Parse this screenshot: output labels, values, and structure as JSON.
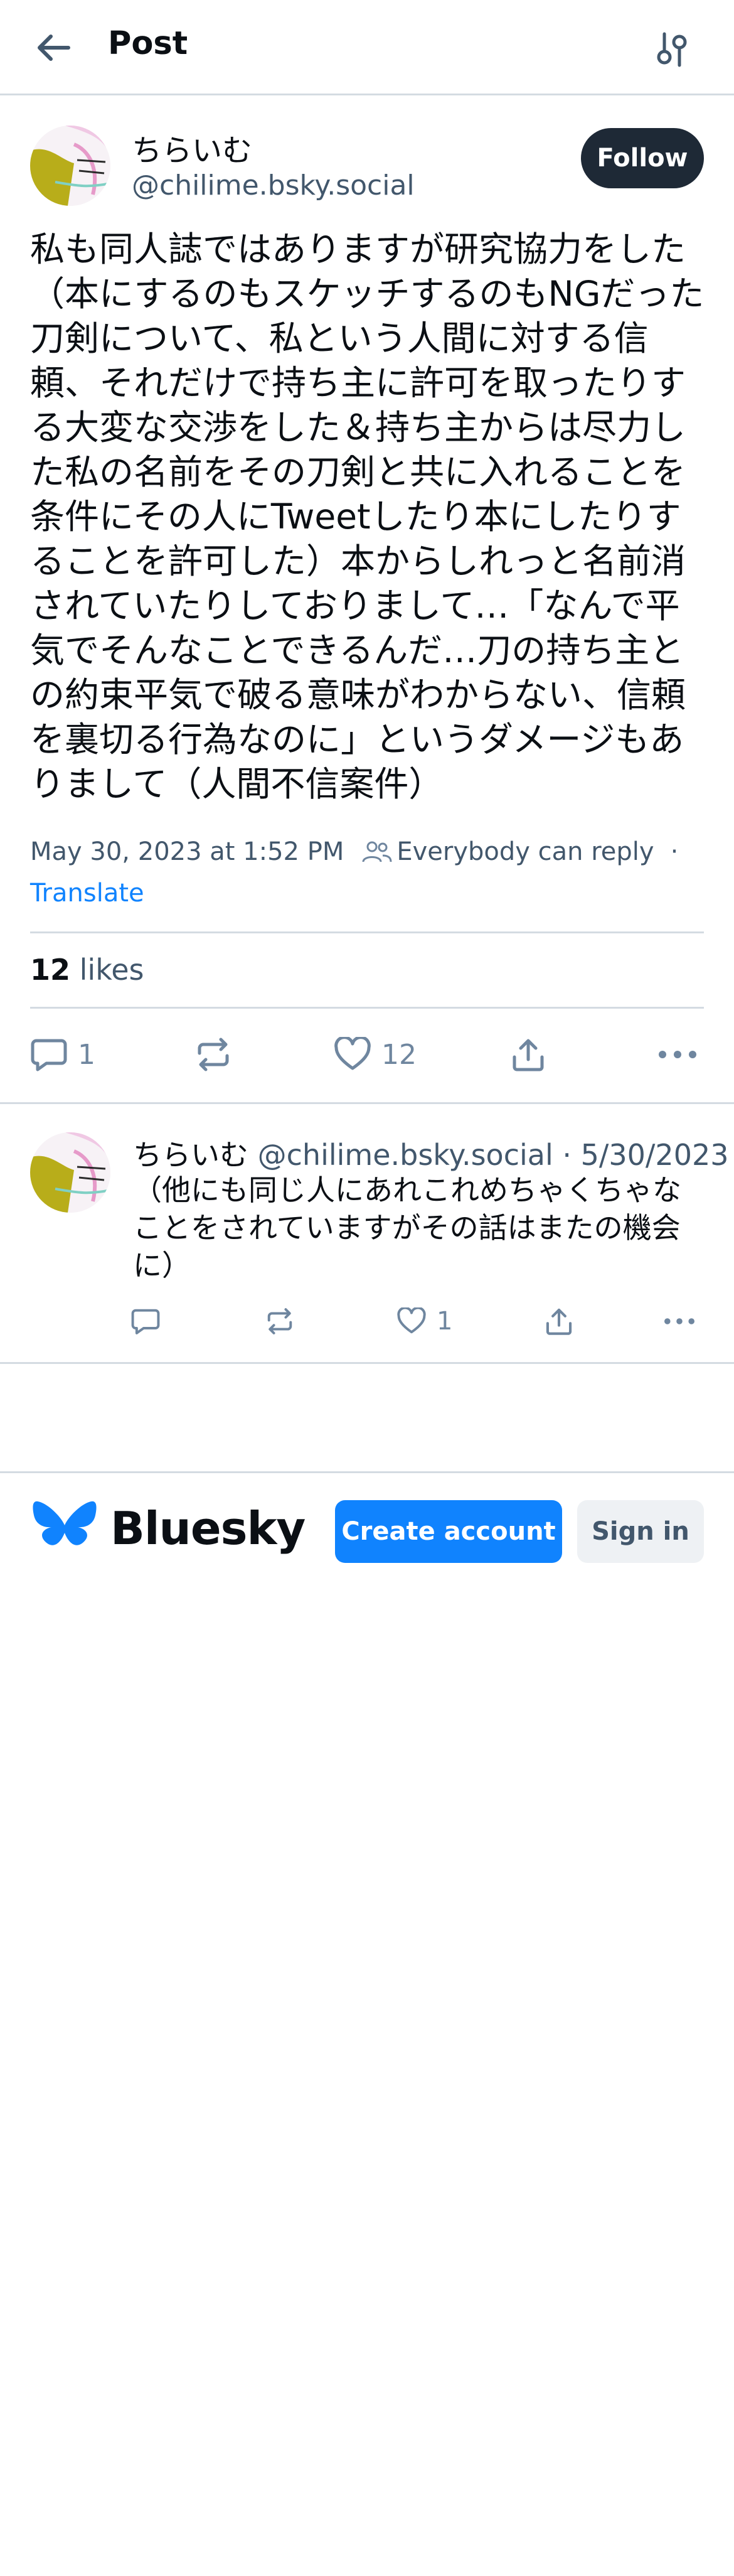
{
  "header": {
    "title": "Post",
    "back_icon": "arrow-left-icon",
    "settings_icon": "sliders-icon"
  },
  "post": {
    "author": {
      "display_name": "ちらいむ",
      "handle": "@chilime.bsky.social"
    },
    "follow_label": "Follow",
    "text": "私も同人誌ではありますが研究協力をした（本にするのもスケッチするのもNGだった刀剣について、私という人間に対する信頼、それだけで持ち主に許可を取ったりする大変な交渉をした＆持ち主からは尽力した私の名前をその刀剣と共に入れることを条件にその人にTweetしたり本にしたりすることを許可した）本からしれっと名前消されていたりしておりまして…「なんで平気でそんなことできるんだ…刀の持ち主との約束平気で破る意味がわからない、信頼を裏切る行為なのに」というダメージもありまして（人間不信案件）",
    "timestamp": "May 30, 2023 at 1:52 PM",
    "audience": "Everybody can reply",
    "meta_separator": "·",
    "translate_label": "Translate",
    "likes_count": "12",
    "likes_label": "likes",
    "actions": {
      "reply_count": "1",
      "repost_count": "",
      "like_count": "12"
    }
  },
  "reply": {
    "author": {
      "display_name": "ちらいむ",
      "handle": "@chilime.bsky.social"
    },
    "separator": "·",
    "date": "5/30/2023",
    "text": "（他にも同じ人にあれこれめちゃくちゃなことをされていますがその話はまたの機会に）",
    "actions": {
      "reply_count": "",
      "repost_count": "",
      "like_count": "1"
    }
  },
  "footer": {
    "brand_name": "Bluesky",
    "create_account_label": "Create account",
    "sign_in_label": "Sign in"
  },
  "colors": {
    "text_primary": "#0b0f14",
    "text_secondary": "#42576c",
    "icon_muted": "#6f869f",
    "accent_blue": "#1083fe",
    "follow_button": "#1e2936",
    "divider": "#d4dbe2"
  }
}
